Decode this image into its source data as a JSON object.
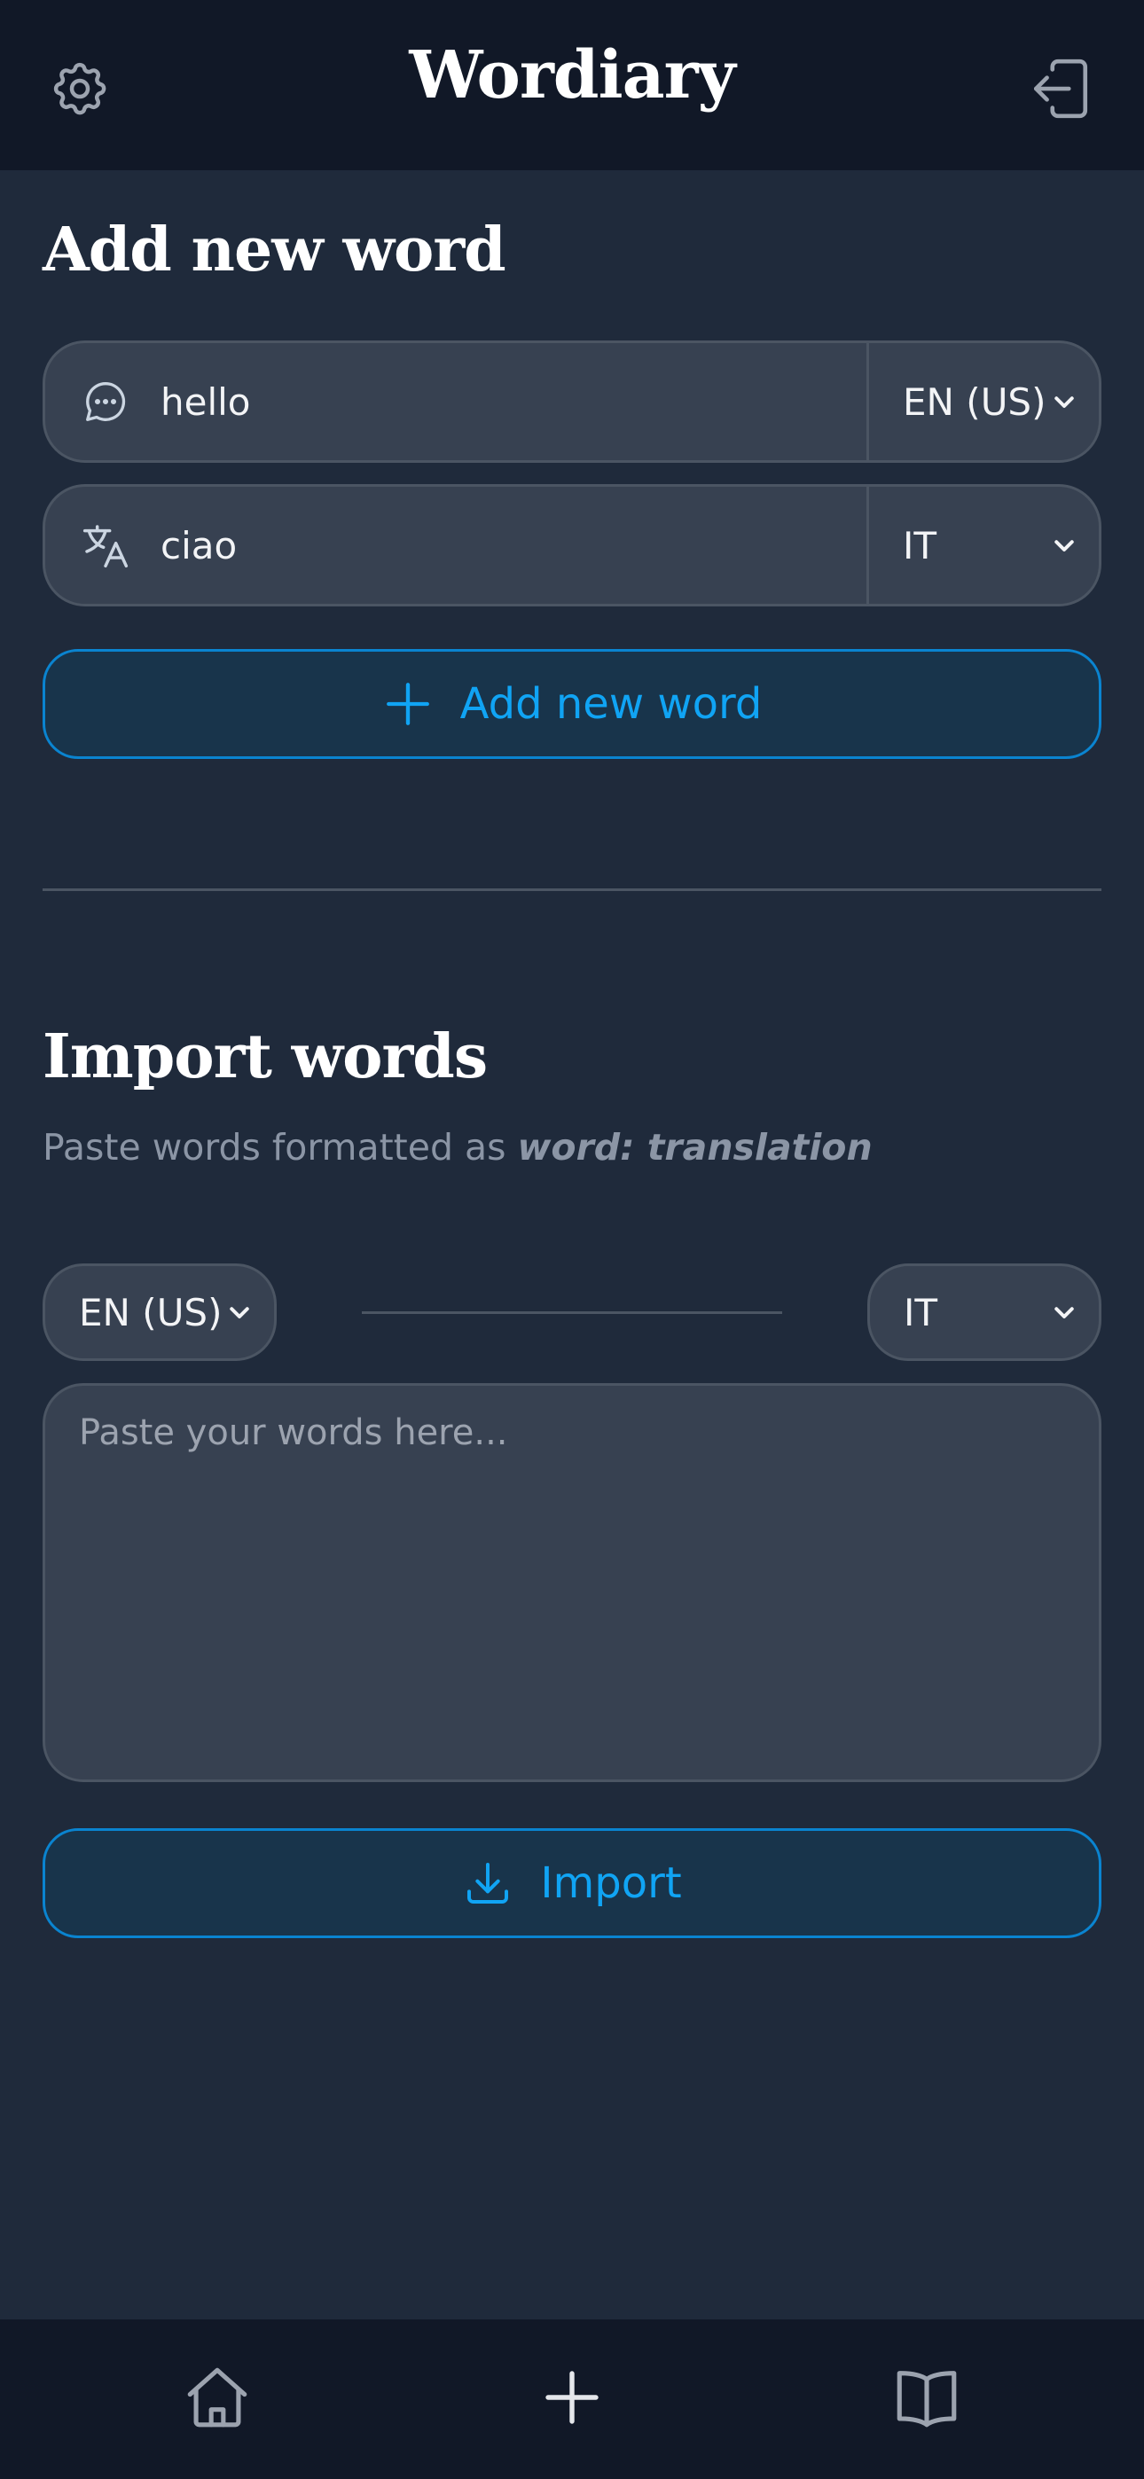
{
  "header": {
    "title": "Wordiary",
    "settings_icon": "gear-icon",
    "logout_icon": "logout-icon"
  },
  "add_word": {
    "title": "Add new word",
    "word": {
      "icon": "chat-bubble-icon",
      "value": "hello",
      "language": "EN (US)"
    },
    "translation": {
      "icon": "translate-icon",
      "value": "ciao",
      "language": "IT"
    },
    "button_label": "Add new word"
  },
  "import": {
    "title": "Import words",
    "subtitle_prefix": "Paste words formatted as ",
    "subtitle_format": "word: translation",
    "source_language": "EN (US)",
    "target_language": "IT",
    "textarea_placeholder": "Paste your words here...",
    "button_label": "Import"
  },
  "nav": {
    "items": [
      {
        "icon": "home-icon",
        "name": "Home"
      },
      {
        "icon": "plus-icon",
        "name": "Add"
      },
      {
        "icon": "book-icon",
        "name": "Dictionary"
      }
    ]
  },
  "colors": {
    "background": "#1f2a3b",
    "bar": "#111827",
    "accent": "#10a4f4",
    "field": "#374151"
  }
}
